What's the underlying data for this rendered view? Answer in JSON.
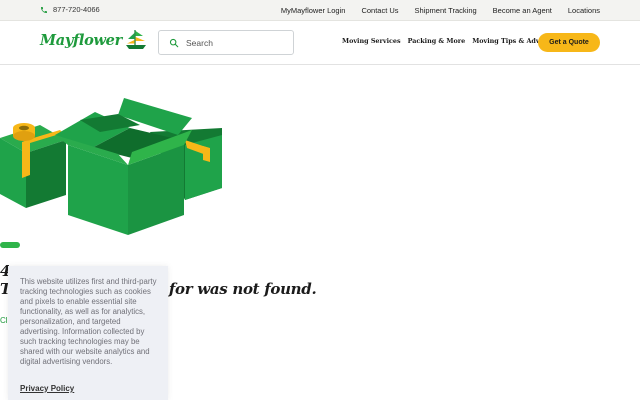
{
  "utility_bar": {
    "phone": "877-720-4066",
    "links": [
      "MyMayflower Login",
      "Contact Us",
      "Shipment Tracking",
      "Become an Agent",
      "Locations"
    ]
  },
  "header": {
    "logo": "Mayflower",
    "search": {
      "placeholder": "Search",
      "value": ""
    },
    "nav": [
      "Moving Services",
      "Packing & More",
      "Moving Tips & Advice"
    ],
    "cta": "Get a Quote"
  },
  "main": {
    "error_code": "4",
    "error_message_start": "T",
    "error_message_end": "for was not found.",
    "link_text": "Cl"
  },
  "cookie_banner": {
    "text": "This website utilizes first and third-party tracking technologies such as cookies and pixels to enable essential site functionality, as well as for analytics, personalization, and targeted advertising. Information collected by such tracking technologies may be shared with our website analytics and digital advertising vendors.",
    "privacy_link": "Privacy Policy"
  },
  "colors": {
    "brand_green": "#1e9a3c",
    "box_green": "#1fa34a",
    "box_dark": "#137a33",
    "accent_yellow": "#f7b718",
    "cookie_bg": "#eef0f5"
  },
  "icons": {
    "phone": "phone-icon",
    "search": "search-icon",
    "logo": "ship-icon"
  }
}
